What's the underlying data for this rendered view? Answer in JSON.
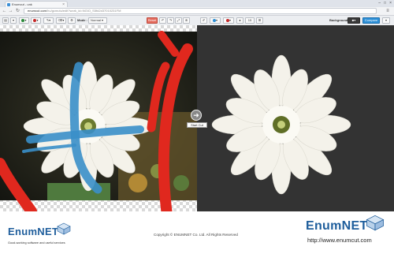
{
  "browser": {
    "tab_title": "Enumcut - unk",
    "url_host": "enumcut.com",
    "url_path": "/hu/gcmutu/edit?work_id=NGIO_S5fd2d37010231FM"
  },
  "toolbar": {
    "mode_label": "Mode :",
    "mode_value": "Normal",
    "reset_label": "Reset",
    "size_value": "15",
    "background_label": "Background",
    "compare_label": "Compare"
  },
  "canvas": {
    "start_cut_label": "Start Cut"
  },
  "footer": {
    "brand_left": "EnumNET",
    "tagline": "Good-working software and useful services",
    "copyright": "Copyright © ENUMNET Co. Ltd. All Rights Reserved",
    "brand_right": "EnumNET",
    "url": "http://www.enumcut.com"
  },
  "colors": {
    "accent": "#2c8fd6",
    "reset": "#e46b5d",
    "brand": "#1f5e9c",
    "result_bg": "#333333"
  }
}
